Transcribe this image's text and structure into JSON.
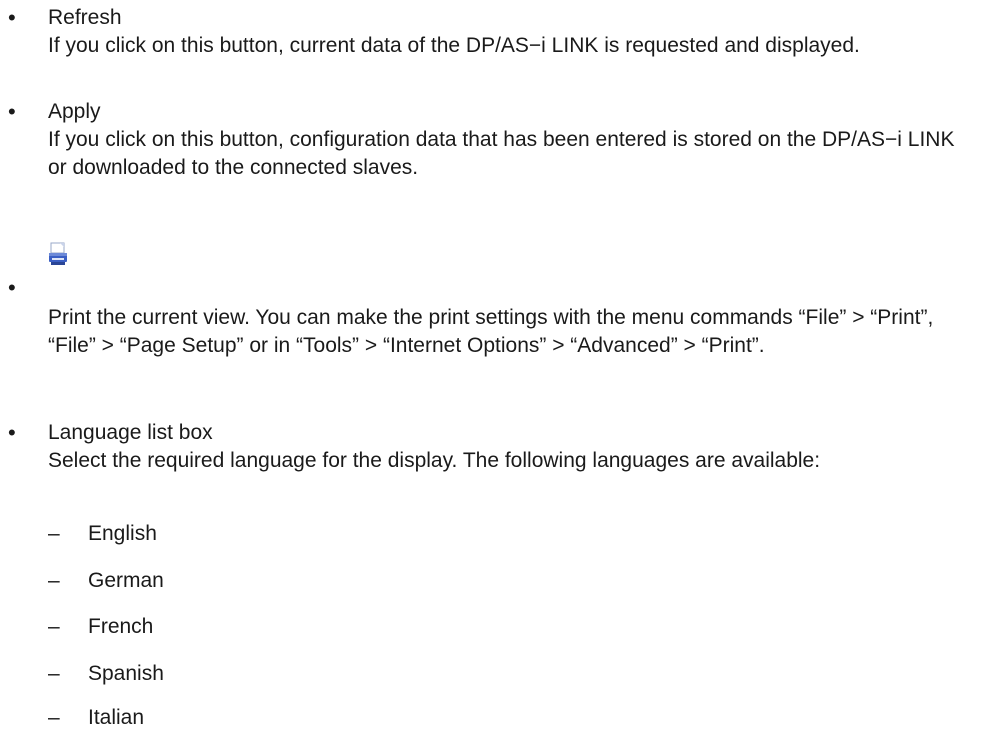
{
  "items": [
    {
      "title": "Refresh",
      "description": "If you click on this button, current data of the DP/AS−i LINK is requested and displayed."
    },
    {
      "title": "Apply",
      "description": "If you click on this button, configuration data that has been entered is stored on the DP/AS−i LINK or downloaded to the connected slaves."
    },
    {
      "title": "",
      "icon": "print-icon",
      "description": "Print the current view. You can make the print settings with the menu commands “File” > “Print”, “File” > “Page Setup” or in “Tools” > “Internet Options” > “Advanced” > “Print”."
    },
    {
      "title": "Language list box",
      "description": "Select the required language for the display. The following languages are available:"
    }
  ],
  "languages": [
    "English",
    "German",
    "French",
    "Spanish",
    "Italian"
  ],
  "bullet_glyph": "•",
  "dash_glyph": "–",
  "colors": {
    "text": "#1a1a1a",
    "icon_blue": "#3b5fc4",
    "icon_light": "#dfe6f7"
  }
}
